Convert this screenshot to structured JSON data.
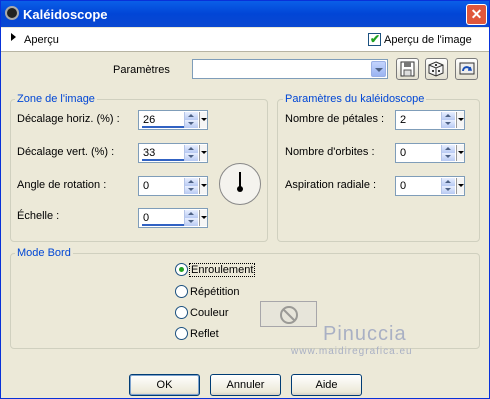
{
  "window": {
    "title": "Kaléidoscope",
    "close_glyph": "✕",
    "app_icon": "kaleidoscope-app-icon"
  },
  "preview_bar": {
    "toggle_label": "Aperçu",
    "checkbox_label": "Aperçu de l'image",
    "checkbox_checked": true
  },
  "presets": {
    "label": "Paramètres",
    "value": "",
    "icons": [
      "save-preset-icon",
      "randomize-icon",
      "reset-icon"
    ]
  },
  "image_zone": {
    "title": "Zone de l'image",
    "h_offset_label": "Décalage horiz. (%) :",
    "h_offset_value": "26",
    "v_offset_label": "Décalage vert. (%) :",
    "v_offset_value": "33",
    "rotation_label": "Angle de rotation :",
    "rotation_value": "0",
    "scale_label": "Échelle :",
    "scale_value": "0"
  },
  "kaleidoscope": {
    "title": "Paramètres du kaléidoscope",
    "petals_label": "Nombre de pétales :",
    "petals_value": "2",
    "orbits_label": "Nombre d'orbites :",
    "orbits_value": "0",
    "suction_label": "Aspiration radiale :",
    "suction_value": "0"
  },
  "edge_mode": {
    "title": "Mode Bord",
    "options": [
      "Enroulement",
      "Répétition",
      "Couleur",
      "Reflet"
    ],
    "selected": "Enroulement"
  },
  "watermark": {
    "name": "Pinuccia",
    "url": "www.maidiregrafica.eu"
  },
  "footer": {
    "ok_label": "OK",
    "cancel_label": "Annuler",
    "help_label": "Aide"
  },
  "colors": {
    "title_bar": "#0145d6",
    "group_title": "#0046d5",
    "window_bg": "#ece9d8",
    "check_green": "#21a121"
  }
}
